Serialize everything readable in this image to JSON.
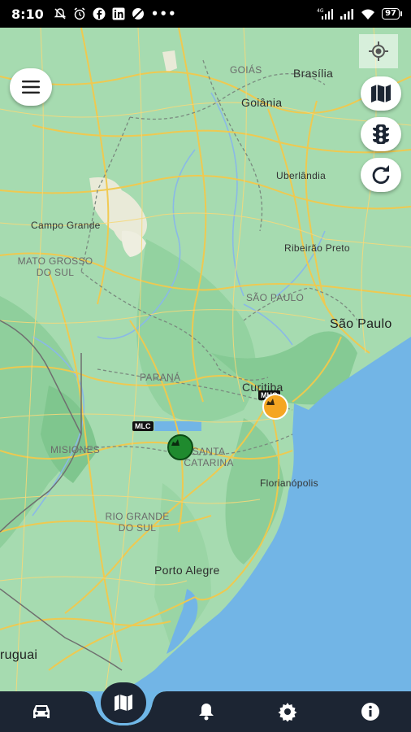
{
  "status_bar": {
    "time": "8:10",
    "battery": "97",
    "left_icons": [
      "mute-icon",
      "alarm-icon",
      "facebook-icon",
      "linkedin-icon",
      "no-sim-icon",
      "more-dots-icon"
    ],
    "right_icons": [
      "signal-4g-icon",
      "signal-icon",
      "wifi-icon",
      "battery-icon"
    ]
  },
  "map": {
    "labels": {
      "goias_state": "GOIÁS",
      "brasilia": "Brasília",
      "goiania": "Goiânia",
      "uberlandia": "Uberlândia",
      "campo_grande": "Campo Grande",
      "mato_grosso_l1": "MATO GROSSO",
      "mato_grosso_l2": "DO SUL",
      "ribeirao": "Ribeirão Preto",
      "sao_paulo_state": "SÃO PAULO",
      "sao_paulo_city": "São Paulo",
      "parana": "PARANÁ",
      "curitiba": "Curitiba",
      "misiones": "MISIONES",
      "santa_l1": "SANTA",
      "santa_l2": "CATARINA",
      "florianopolis": "Florianópolis",
      "rio_grande_l1": "RIO GRANDE",
      "rio_grande_l2": "DO SUL",
      "porto_alegre": "Porto Alegre",
      "uruguai": "ruguai"
    },
    "markers": [
      {
        "tag": "MHC",
        "color": "#f5a623"
      },
      {
        "tag": "MLC",
        "color": "#1f8a2e"
      }
    ]
  },
  "controls": {
    "menu_icon": "hamburger-menu-icon",
    "locate_icon": "my-location-icon",
    "map_type_icon": "map-icon",
    "traffic_icon": "traffic-light-icon",
    "refresh_icon": "refresh-icon"
  },
  "bottom_nav": {
    "items": [
      "car-icon",
      "map-icon",
      "bell-icon",
      "gear-icon",
      "info-icon"
    ],
    "active": "map-icon",
    "bar_color": "#1c2533",
    "active_bg": "#6fb7e8"
  }
}
